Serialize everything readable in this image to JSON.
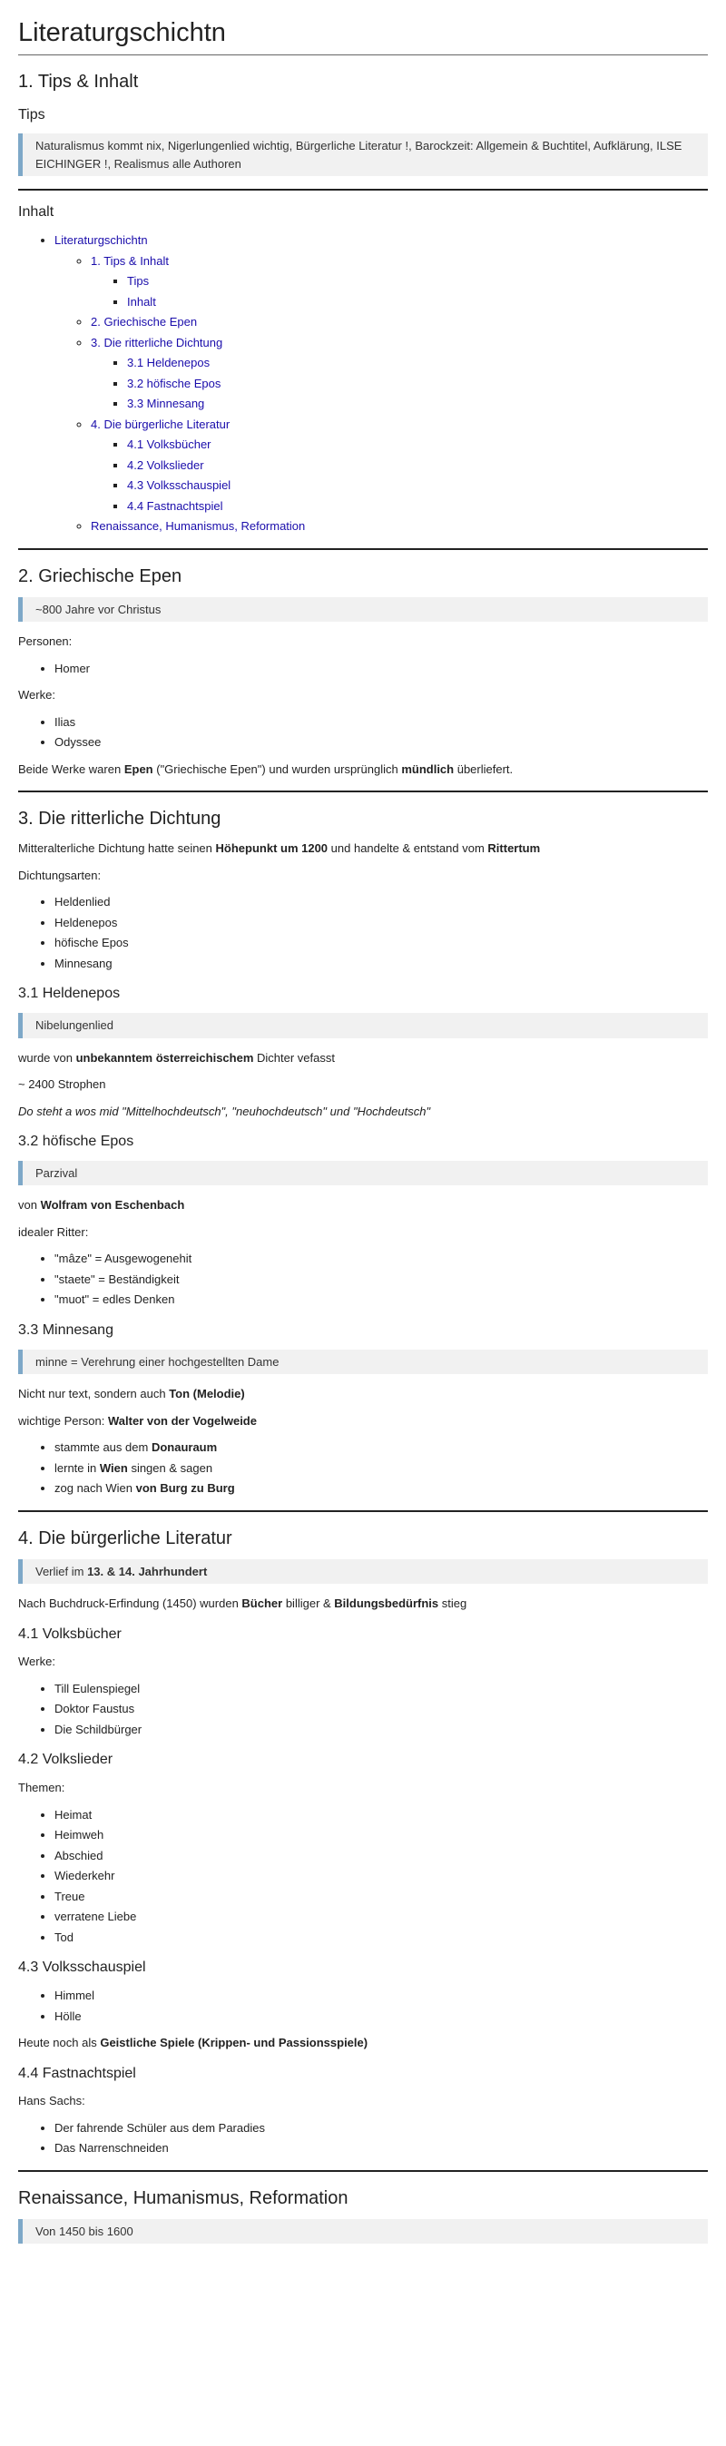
{
  "title": "Literaturgschichtn",
  "sec1": {
    "heading": "1. Tips & Inhalt",
    "tips_heading": "Tips",
    "tips_text": "Naturalismus kommt nix, Nigerlungenlied wichtig, Bürgerliche Literatur !, Barockzeit: Allgemein & Buchtitel, Aufklärung, ILSE EICHINGER !, Realismus alle Authoren",
    "inhalt_heading": "Inhalt",
    "toc": {
      "root": "Literaturgschichtn",
      "s1": "1. Tips & Inhalt",
      "s1a": "Tips",
      "s1b": "Inhalt",
      "s2": "2. Griechische Epen",
      "s3": "3. Die ritterliche Dichtung",
      "s31": "3.1 Heldenepos",
      "s32": "3.2 höfische Epos",
      "s33": "3.3 Minnesang",
      "s4": "4. Die bürgerliche Literatur",
      "s41": "4.1 Volksbücher",
      "s42": "4.2 Volkslieder",
      "s43": "4.3 Volksschauspiel",
      "s44": "4.4 Fastnachtspiel",
      "s5": "Renaissance, Humanismus, Reformation"
    }
  },
  "sec2": {
    "heading": "2. Griechische Epen",
    "callout": "~800 Jahre vor Christus",
    "personen_label": "Personen:",
    "personen": [
      "Homer"
    ],
    "werke_label": "Werke:",
    "werke": [
      "Ilias",
      "Odyssee"
    ],
    "summary": {
      "a": "Beide Werke waren ",
      "b": "Epen",
      "c": " (\"Griechische Epen\") und wurden ursprünglich ",
      "d": "mündlich",
      "e": " überliefert."
    }
  },
  "sec3": {
    "heading": "3. Die ritterliche Dichtung",
    "intro": {
      "a": "Mitteralterliche Dichtung hatte seinen ",
      "b": "Höhepunkt um 1200",
      "c": " und handelte & entstand vom ",
      "d": "Rittertum"
    },
    "arten_label": "Dichtungsarten:",
    "arten": [
      "Heldenlied",
      "Heldenepos",
      "höfische Epos",
      "Minnesang"
    ],
    "s31": {
      "heading": "3.1 Heldenepos",
      "callout": "Nibelungenlied",
      "line1": {
        "a": "wurde von ",
        "b": "unbekanntem österreichischem",
        "c": " Dichter vefasst"
      },
      "line2": "~ 2400 Strophen",
      "line3": "Do steht a wos mid \"Mittelhochdeutsch\", \"neuhochdeutsch\" und \"Hochdeutsch\""
    },
    "s32": {
      "heading": "3.2 höfische Epos",
      "callout": "Parzival",
      "author": {
        "a": "von ",
        "b": "Wolfram von Eschenbach"
      },
      "ritter_label": "idealer Ritter:",
      "ritter": [
        "\"mâze\" = Ausgewogenehit",
        "\"staete\" = Beständigkeit",
        "\"muot\" = edles Denken"
      ]
    },
    "s33": {
      "heading": "3.3 Minnesang",
      "callout": "minne = Verehrung einer hochgestellten Dame",
      "line1": {
        "a": "Nicht nur text, sondern auch ",
        "b": "Ton (Melodie)"
      },
      "line2": {
        "a": "wichtige Person: ",
        "b": "Walter von der Vogelweide"
      },
      "items": [
        {
          "a": "stammte aus dem ",
          "b": "Donauraum",
          "c": ""
        },
        {
          "a": "lernte in ",
          "b": "Wien",
          "c": " singen & sagen"
        },
        {
          "a": "zog nach Wien ",
          "b": "von Burg zu Burg",
          "c": ""
        }
      ]
    }
  },
  "sec4": {
    "heading": "4. Die bürgerliche Literatur",
    "callout": {
      "a": "Verlief im ",
      "b": "13. & 14. Jahrhundert"
    },
    "intro": {
      "a": "Nach Buchdruck-Erfindung (1450) wurden ",
      "b": "Bücher",
      "c": " billiger & ",
      "d": "Bildungsbedürfnis",
      "e": " stieg"
    },
    "s41": {
      "heading": "4.1 Volksbücher",
      "label": "Werke:",
      "items": [
        "Till Eulenspiegel",
        "Doktor Faustus",
        "Die Schildbürger"
      ]
    },
    "s42": {
      "heading": "4.2 Volkslieder",
      "label": "Themen:",
      "items": [
        "Heimat",
        "Heimweh",
        "Abschied",
        "Wiederkehr",
        "Treue",
        "verratene Liebe",
        "Tod"
      ]
    },
    "s43": {
      "heading": "4.3 Volksschauspiel",
      "items": [
        "Himmel",
        "Hölle"
      ],
      "note": {
        "a": "Heute noch als ",
        "b": "Geistliche Spiele (Krippen- und Passionsspiele)"
      }
    },
    "s44": {
      "heading": "4.4 Fastnachtspiel",
      "label": "Hans Sachs:",
      "items": [
        "Der fahrende Schüler aus dem Paradies",
        "Das Narrenschneiden"
      ]
    }
  },
  "sec5": {
    "heading": "Renaissance, Humanismus, Reformation",
    "callout": "Von 1450 bis 1600"
  }
}
